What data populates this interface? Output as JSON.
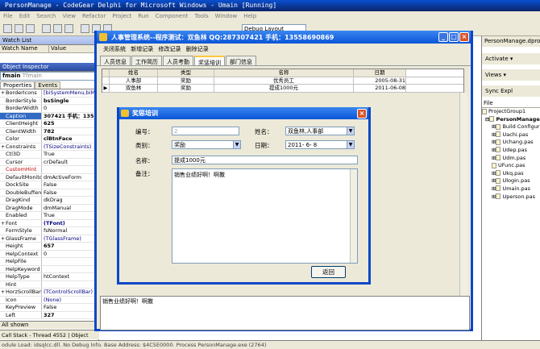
{
  "ide": {
    "title": "PersonManage - CodeGear Delphi for Microsoft Windows - Umain [Running]",
    "menu": [
      "File",
      "Edit",
      "Search",
      "View",
      "Refactor",
      "Project",
      "Run",
      "Component",
      "Tools",
      "Window",
      "Help"
    ],
    "layout_select": "Debug Layout"
  },
  "watch": {
    "title": "Watch List",
    "col_name": "Watch Name",
    "col_value": "Value"
  },
  "inspector": {
    "title": "Object Inspector",
    "component": "fmain",
    "component_type": "Tfmain",
    "tab_properties": "Properties",
    "tab_events": "Events",
    "rows": [
      {
        "n": "BorderIcons",
        "v": "[biSystemMenu,biMinim"
      },
      {
        "n": "BorderStyle",
        "v": "bsSingle"
      },
      {
        "n": "BorderWidth",
        "v": "0"
      },
      {
        "n": "Caption",
        "v": "307421 手机：1355"
      },
      {
        "n": "ClientHeight",
        "v": "625"
      },
      {
        "n": "ClientWidth",
        "v": "782"
      },
      {
        "n": "Color",
        "v": "clBtnFace"
      },
      {
        "n": "Constraints",
        "v": "(TSizeConstraints)"
      },
      {
        "n": "Ctl3D",
        "v": "True"
      },
      {
        "n": "Cursor",
        "v": "crDefault"
      },
      {
        "n": "CustomHint",
        "v": ""
      },
      {
        "n": "DefaultMonitor",
        "v": "dmActiveForm"
      },
      {
        "n": "DockSite",
        "v": "False"
      },
      {
        "n": "DoubleBuffered",
        "v": "False"
      },
      {
        "n": "DragKind",
        "v": "dkDrag"
      },
      {
        "n": "DragMode",
        "v": "dmManual"
      },
      {
        "n": "Enabled",
        "v": "True"
      },
      {
        "n": "Font",
        "v": "(TFont)"
      },
      {
        "n": "FormStyle",
        "v": "fsNormal"
      },
      {
        "n": "GlassFrame",
        "v": "(TGlassFrame)"
      },
      {
        "n": "Height",
        "v": "657"
      },
      {
        "n": "HelpContext",
        "v": "0"
      },
      {
        "n": "HelpFile",
        "v": ""
      },
      {
        "n": "HelpKeyword",
        "v": ""
      },
      {
        "n": "HelpType",
        "v": "htContext"
      },
      {
        "n": "Hint",
        "v": ""
      },
      {
        "n": "HorzScrollBar",
        "v": "(TControlScrollBar)"
      },
      {
        "n": "Icon",
        "v": "(None)"
      },
      {
        "n": "KeyPreview",
        "v": "False"
      },
      {
        "n": "Left",
        "v": "327"
      }
    ],
    "all_shown": "All shown"
  },
  "callstack": {
    "label": "Call Stack - Thread 4552",
    "object_tab": "Object"
  },
  "statusbar": "odule Load: idsqlcc.dll. No Debug Info. Base Address: $4C5E0000. Process PersonManage.exe (2764)",
  "project": {
    "tab": "PersonManage.dpro",
    "activate": "Activate",
    "views": "Views",
    "sync": "Sync",
    "expl": "Expl",
    "file_header": "File",
    "group": "ProjectGroup1",
    "project": "PersonManage",
    "files": [
      "Build Configur",
      "Uachi.pas",
      "Uchang.pas",
      "Udep.pas",
      "Udm.pas",
      "UFunc.pas",
      "Ukq.pas",
      "Ulogin.pas",
      "Umain.pas",
      "Uperson.pas"
    ]
  },
  "app": {
    "title": "人事管理系统--程序测试：双鱼林 QQ:287307421 手机：13558690869",
    "menu": [
      "关闭系统",
      "新增记录",
      "修改记录",
      "删除记录"
    ],
    "tabs": [
      "人员信息",
      "工作简历",
      "人员考勤",
      "奖惩培训",
      "部门信息"
    ],
    "grid_headers": [
      "姓名",
      "类型",
      "名称",
      "日期"
    ],
    "grid_rows": [
      [
        "人事部",
        "奖励",
        "优秀员工",
        "2005-08-31"
      ],
      [
        "双鱼林",
        "奖励",
        "提成1000元",
        "2011-06-08"
      ]
    ],
    "memo_out": "销售业绩好啊！啊撒"
  },
  "dialog": {
    "title": "奖惩培训",
    "lbl_id": "编号：",
    "id_value": "2",
    "lbl_name": "姓名：",
    "name_value": "双鱼林,人事部",
    "lbl_type": "类别：",
    "type_value": "奖励",
    "lbl_date": "日期：",
    "date_value": "2011- 6- 8",
    "lbl_title": "名称：",
    "title_value": "提成1000元",
    "lbl_note": "备注：",
    "note_value": "销售业绩好啊！啊撒",
    "back_button": "返回"
  }
}
